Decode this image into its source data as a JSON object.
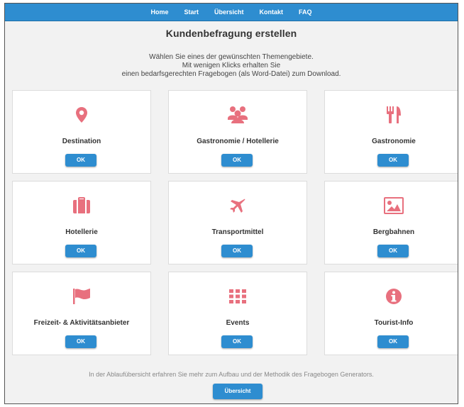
{
  "nav": {
    "items": [
      "Home",
      "Start",
      "Übersicht",
      "Kontakt",
      "FAQ"
    ]
  },
  "page": {
    "title": "Kundenbefragung erstellen",
    "intro_line1": "Wählen Sie eines der gewünschten Themengebiete.",
    "intro_line2": "Mit wenigen Klicks erhalten Sie",
    "intro_line3": "einen bedarfsgerechten Fragebogen (als Word-Datei) zum Download."
  },
  "cards": [
    {
      "label": "Destination",
      "icon": "map-pin-icon",
      "button": "OK"
    },
    {
      "label": "Gastronomie / Hotellerie",
      "icon": "people-group-icon",
      "button": "OK"
    },
    {
      "label": "Gastronomie",
      "icon": "fork-knife-icon",
      "button": "OK"
    },
    {
      "label": "Hotellerie",
      "icon": "suitcase-icon",
      "button": "OK"
    },
    {
      "label": "Transportmittel",
      "icon": "airplane-icon",
      "button": "OK"
    },
    {
      "label": "Bergbahnen",
      "icon": "picture-icon",
      "button": "OK"
    },
    {
      "label": "Freizeit- & Aktivitätsanbieter",
      "icon": "flag-icon",
      "button": "OK"
    },
    {
      "label": "Events",
      "icon": "grid-dots-icon",
      "button": "OK"
    },
    {
      "label": "Tourist-Info",
      "icon": "info-icon",
      "button": "OK"
    }
  ],
  "footer": {
    "text": "In der Ablaufübersicht erfahren Sie mehr zum Aufbau und der Methodik des Fragebogen Generators.",
    "button": "Übersicht"
  },
  "colors": {
    "nav": "#2e8dd0",
    "button": "#2e8dd0",
    "icon": "#e8707e",
    "background": "#f2f2f2"
  }
}
